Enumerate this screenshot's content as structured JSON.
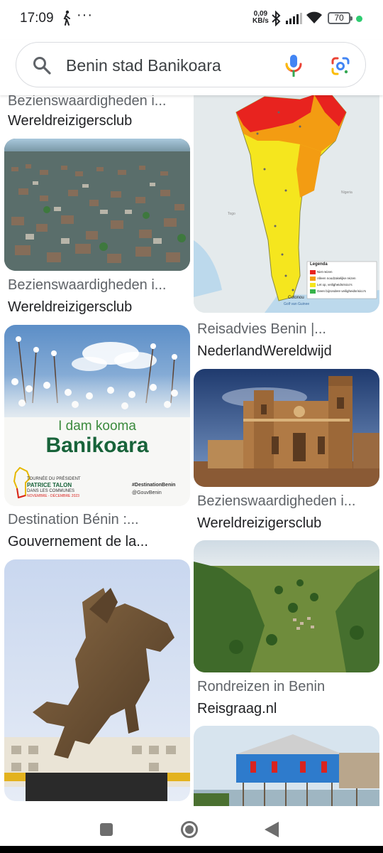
{
  "status_bar": {
    "time": "17:09",
    "overflow_dots": "···",
    "network_speed_value": "0,09",
    "network_speed_unit": "KB/s",
    "battery_level": "70",
    "icons": [
      "walking-person-icon",
      "bluetooth-icon",
      "cellular-signal-icon",
      "wifi-icon",
      "battery-icon",
      "notification-dot-icon"
    ],
    "dot_color": "#2ecc71"
  },
  "search": {
    "query": "Benin stad Banikoara",
    "icons": [
      "search-icon",
      "microphone-icon",
      "google-lens-icon"
    ]
  },
  "results": {
    "left_column": [
      {
        "title": "Bezienswaardigheden i...",
        "source": "Wereldreizigersclub"
      },
      {
        "title": "Bezienswaardigheden i...",
        "source": "Wereldreizigersclub",
        "image": "stilt-village-aerial"
      },
      {
        "title": "Destination Bénin :...",
        "source": "Gouvernement de la...",
        "image": "banikoara-poster"
      },
      {
        "title": "",
        "source": "",
        "image": "equestrian-statue"
      }
    ],
    "right_column": [
      {
        "title": "Reisadvies Benin |...",
        "source": "NederlandWereldwijd",
        "image": "benin-travel-advice-map"
      },
      {
        "title": "Bezienswaardigheden i...",
        "source": "Wereldreizigersclub",
        "image": "basilica"
      },
      {
        "title": "Rondreizen in Benin",
        "source": "Reisgraag.nl",
        "image": "green-landscape"
      },
      {
        "title": "",
        "source": "",
        "image": "blue-stilt-house"
      }
    ]
  },
  "poster": {
    "subtitle": "I dam kooma",
    "title": "Banikoara",
    "line1": "TOURNÉE DU PRÉSIDENT",
    "line2": "PATRICE TALON",
    "line3": "DANS LES COMMUNES",
    "line4": "NOVEMBRE - DÉCEMBRE 2023",
    "hashtag": "#DestinationBenin",
    "handle": "@GouvBenin"
  },
  "map": {
    "legend_title": "Legenda",
    "legend": [
      "Niet reizen",
      "Alleen noodzakelijke reizen",
      "Let op, veiligheidsrisico's",
      "Geen bijzondere veiligheidsrisico's"
    ],
    "legend_colors": [
      "#e8231f",
      "#f39c12",
      "#f5e61e",
      "#37b34a"
    ],
    "city_bottom": "Cotonou",
    "gulf": "Golf van Guinee",
    "neighbor_east": "Nigeria",
    "neighbor_west": "Togo"
  },
  "nav_bar": {
    "icons": [
      "recent-apps-icon",
      "home-icon",
      "back-icon"
    ]
  }
}
